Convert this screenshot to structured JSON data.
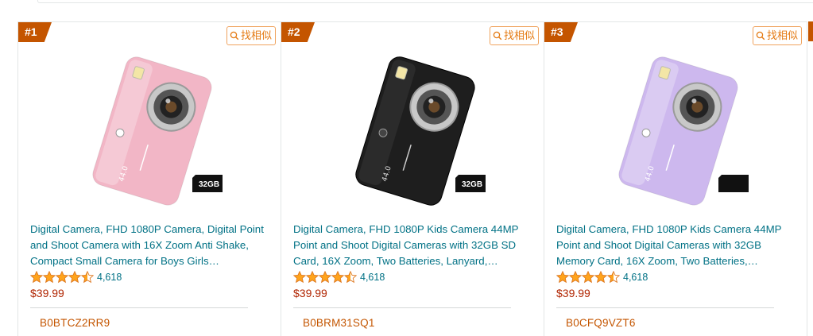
{
  "similar_label": "找相似",
  "products": [
    {
      "rank": "#1",
      "title": "Digital Camera, FHD 1080P Camera, Digital Point and Shoot Camera with 16X Zoom Anti Shake, Compact Small Camera for Boys Girls…",
      "rating": 4.5,
      "rating_count": "4,618",
      "price": "$39.99",
      "asin": "B0BTCZ2RR9",
      "camera_color": "#f2b6c6",
      "card_label": "32GB"
    },
    {
      "rank": "#2",
      "title": "Digital Camera, FHD 1080P Kids Camera 44MP Point and Shoot Digital Cameras with 32GB SD Card, 16X Zoom, Two Batteries, Lanyard,…",
      "rating": 4.5,
      "rating_count": "4,618",
      "price": "$39.99",
      "asin": "B0BRM31SQ1",
      "camera_color": "#1e1e1e",
      "card_label": "32GB"
    },
    {
      "rank": "#3",
      "title": "Digital Camera, FHD 1080P Kids Camera 44MP Point and Shoot Digital Cameras with 32GB Memory Card, 16X Zoom, Two Batteries,…",
      "rating": 4.5,
      "rating_count": "4,618",
      "price": "$39.99",
      "asin": "B0CFQ9VZT6",
      "camera_color": "#cdb8ee",
      "card_label": ""
    }
  ],
  "colors": {
    "rank_badge": "#c45500",
    "link": "#007185",
    "price": "#b12704",
    "asin": "#c45500",
    "star": "#ffa41c"
  }
}
